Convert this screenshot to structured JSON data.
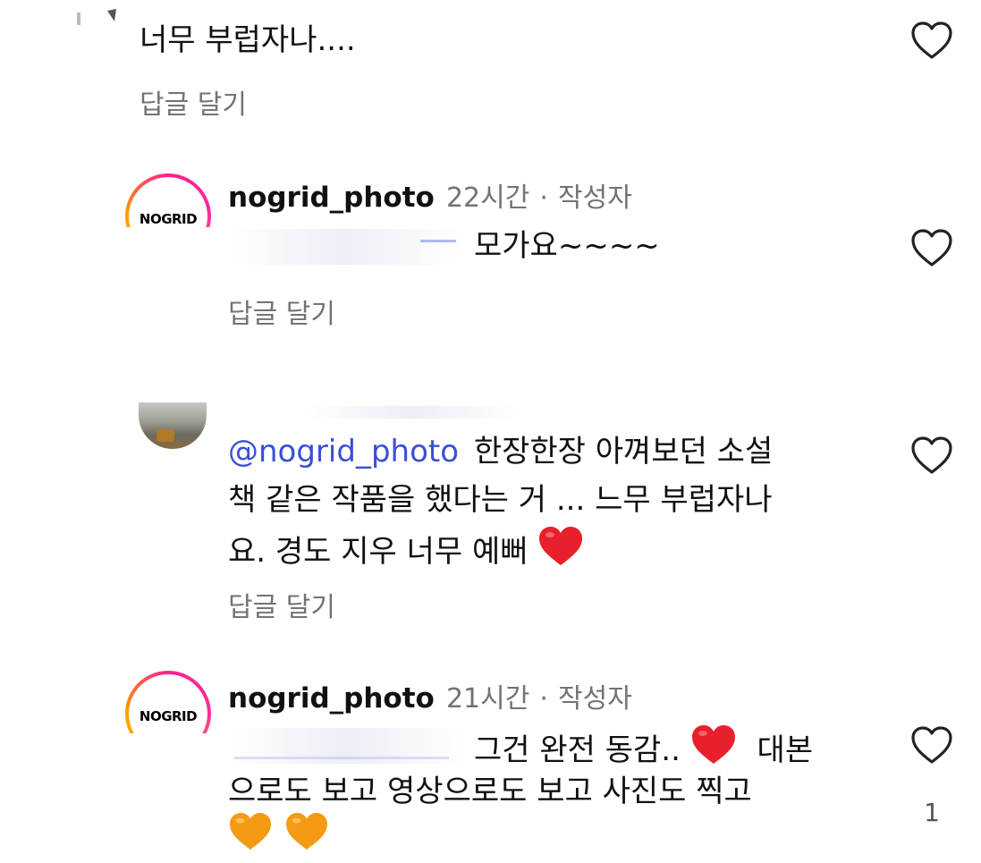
{
  "comments": [
    {
      "text": "너무 부럽자나....",
      "reply_label": "답글 달기"
    },
    {
      "username": "nogrid_photo",
      "time": "22시간",
      "author_tag": "작성자",
      "text": "모가요~~~~",
      "reply_label": "답글 달기"
    },
    {
      "mention": "@nogrid_photo",
      "text_line1": "한장한장 아껴보던 소설",
      "text_line2": "책 같은 작품을 했다는 거 ... 느무 부럽자나",
      "text_line3": "요. 경도 지우 너무 예뻐",
      "reply_label": "답글 달기"
    },
    {
      "username": "nogrid_photo",
      "time": "21시간",
      "author_tag": "작성자",
      "text_line1": "그건 완전 동감..",
      "text_line1b": "대본",
      "text_line2": "으로도 보고 영상으로도 보고 사진도 찍고",
      "like_count": "1"
    }
  ],
  "avatar_logo_text": "NOGRID",
  "separator": "·",
  "icons": {
    "like": "heart-outline-icon",
    "red_heart": "red-heart-emoji",
    "orange_heart": "orange-heart-emoji"
  },
  "colors": {
    "mention": "#3a4fd6",
    "secondary": "#737373",
    "heart_red": "#e8202c",
    "heart_orange": "#f59a12"
  }
}
